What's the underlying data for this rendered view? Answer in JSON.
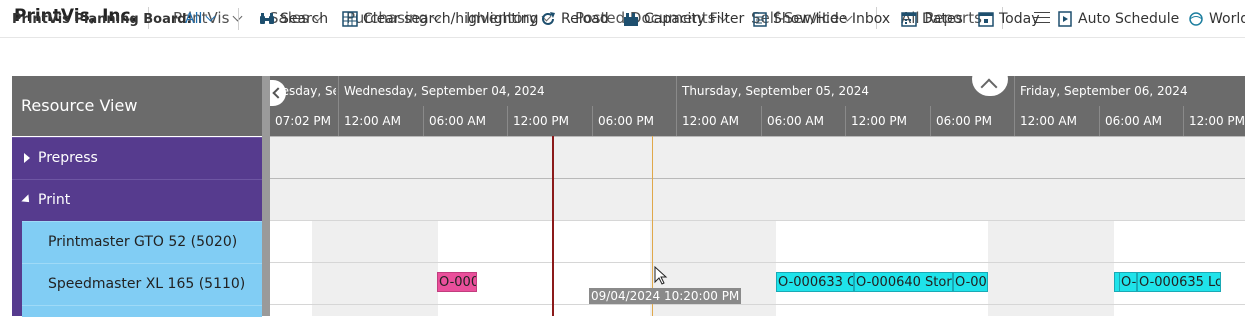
{
  "app": {
    "company": "PrintVis, Inc.",
    "nav": [
      {
        "label": "PrintVis",
        "dropdown": true
      },
      {
        "label": "Sales",
        "dropdown": true
      },
      {
        "label": "Purchasing",
        "dropdown": true
      },
      {
        "label": "Inventory",
        "dropdown": true
      },
      {
        "label": "Posted Documents",
        "dropdown": true
      },
      {
        "label": "Self-Service",
        "dropdown": true
      },
      {
        "label": "All Reports",
        "dropdown": false
      }
    ]
  },
  "toolbar": {
    "board_label": "PrintVis Planning Board:",
    "filter_value": "All",
    "actions": [
      {
        "label": "Search",
        "icon": "binoculars-icon"
      },
      {
        "label": "Clear search/highlighting",
        "icon": "clear-grid-icon"
      },
      {
        "label": "Reload",
        "icon": "reload-icon"
      },
      {
        "label": "Capacity Filter",
        "icon": "capacity-filter-icon"
      },
      {
        "label": "Show/Hide Inbox",
        "icon": "inbox-icon"
      },
      {
        "label": "Dates",
        "icon": "calendar-icon"
      },
      {
        "label": "Today",
        "icon": "today-icon"
      },
      {
        "label": "Auto Schedule",
        "icon": "auto-schedule-icon"
      },
      {
        "label": "World",
        "icon": "world-icon"
      }
    ]
  },
  "resource_view": {
    "title": "Resource View",
    "groups": [
      {
        "label": "Prepress",
        "expanded": false
      },
      {
        "label": "Print",
        "expanded": true
      }
    ],
    "resources": [
      {
        "label": "Printmaster GTO 52 (5020)"
      },
      {
        "label": "Speedmaster XL 165 (5110)"
      }
    ]
  },
  "timeline": {
    "days": [
      "uesday, Se",
      "Wednesday, September 04, 2024",
      "Thursday, September 05, 2024",
      "Friday, September 06, 2024"
    ],
    "hours": [
      "07:02 PM",
      "12:00 AM",
      "06:00 AM",
      "12:00 PM",
      "06:00 PM",
      "12:00 AM",
      "06:00 AM",
      "12:00 PM",
      "06:00 PM",
      "12:00 AM",
      "06:00 AM",
      "12:00 PM"
    ],
    "jobs": [
      {
        "label": "O-000",
        "color": "#ea4f9b"
      },
      {
        "label": "O-000633 C",
        "color": "#1fe3ea"
      },
      {
        "label": "O-000640 Stora",
        "color": "#1fe3ea"
      },
      {
        "label": "O-00",
        "color": "#1fe3ea"
      },
      {
        "label": "",
        "color": "#1fe3ea"
      },
      {
        "label": "O-",
        "color": "#1fe3ea"
      },
      {
        "label": "O-000635 Lo",
        "color": "#1fe3ea"
      }
    ],
    "cursor_tooltip": "09/04/2024 10:20:00 PM"
  },
  "colors": {
    "group_bg": "#563b8e",
    "resource_bg": "#81cdf4",
    "header_bg": "#6b6b6b",
    "now_line": "#8b1a1a",
    "cursor_line": "#e0a84a",
    "accent": "#1f6fb0"
  }
}
